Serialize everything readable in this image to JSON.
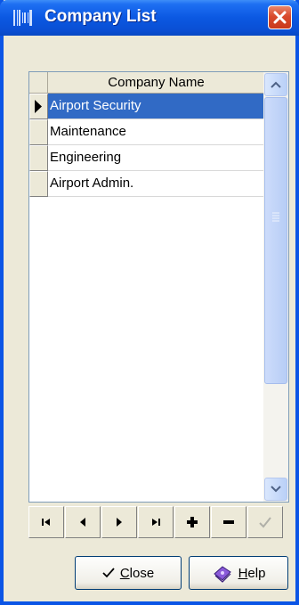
{
  "window": {
    "title": "Company List",
    "close_icon": "close-x-icon",
    "app_icon": "barcode-icon"
  },
  "grid": {
    "column_header": "Company Name",
    "rows": [
      {
        "name": "Airport Security",
        "selected": true
      },
      {
        "name": "Maintenance",
        "selected": false
      },
      {
        "name": "Engineering",
        "selected": false
      },
      {
        "name": "Airport Admin.",
        "selected": false
      }
    ]
  },
  "navigator": {
    "buttons": [
      {
        "name": "first-record-button",
        "icon": "first-icon"
      },
      {
        "name": "prior-record-button",
        "icon": "prior-icon"
      },
      {
        "name": "next-record-button",
        "icon": "next-icon"
      },
      {
        "name": "last-record-button",
        "icon": "last-icon"
      },
      {
        "name": "insert-record-button",
        "icon": "plus-icon"
      },
      {
        "name": "delete-record-button",
        "icon": "minus-icon"
      },
      {
        "name": "post-record-button",
        "icon": "check-icon",
        "enabled": false
      }
    ]
  },
  "buttons": {
    "close_label_accel": "C",
    "close_label_rest": "lose",
    "help_label_accel": "H",
    "help_label_rest": "elp"
  },
  "colors": {
    "title_bar": "#0b58e2",
    "selection": "#316ac5",
    "face": "#ece9d8"
  }
}
